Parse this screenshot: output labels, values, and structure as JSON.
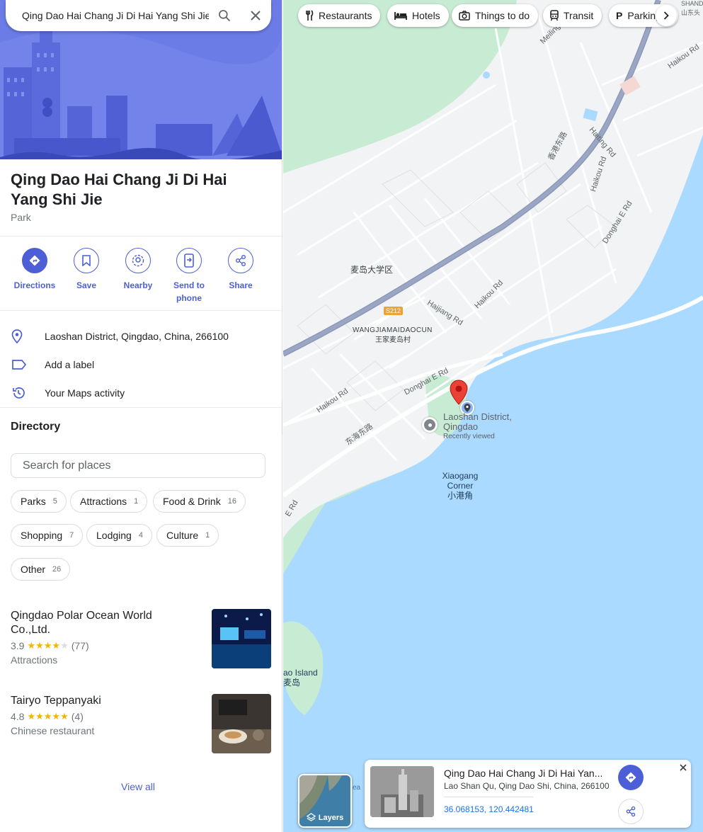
{
  "search": {
    "query": "Qing Dao Hai Chang Ji Di Hai Yang Shi Jie"
  },
  "place": {
    "title": "Qing Dao Hai Chang Ji Di Hai Yang Shi Jie",
    "type": "Park",
    "address": "Laoshan District, Qingdao, China, 266100",
    "add_label": "Add a label",
    "maps_activity": "Your Maps activity"
  },
  "actions": [
    {
      "label": "Directions",
      "icon": "directions-icon"
    },
    {
      "label": "Save",
      "icon": "bookmark-icon"
    },
    {
      "label": "Nearby",
      "icon": "nearby-icon"
    },
    {
      "label": "Send to\nphone",
      "icon": "send-to-phone-icon"
    },
    {
      "label": "Share",
      "icon": "share-icon"
    }
  ],
  "directory": {
    "title": "Directory",
    "search_placeholder": "Search for places",
    "chips": [
      {
        "label": "Parks",
        "count": "5"
      },
      {
        "label": "Attractions",
        "count": "1"
      },
      {
        "label": "Food & Drink",
        "count": "16"
      },
      {
        "label": "Shopping",
        "count": "7"
      },
      {
        "label": "Lodging",
        "count": "4"
      },
      {
        "label": "Culture",
        "count": "1"
      },
      {
        "label": "Other",
        "count": "26"
      }
    ],
    "results": [
      {
        "name": "Qingdao Polar Ocean World Co.,Ltd.",
        "rating": "3.9",
        "stars": 4,
        "reviews": "(77)",
        "category": "Attractions"
      },
      {
        "name": "Tairyo Teppanyaki",
        "rating": "4.8",
        "stars": 5,
        "reviews": "(4)",
        "category": "Chinese restaurant"
      }
    ],
    "view_all": "View all"
  },
  "map": {
    "top_chips": [
      {
        "label": "Restaurants",
        "icon": "fork-knife-icon"
      },
      {
        "label": "Hotels",
        "icon": "bed-icon"
      },
      {
        "label": "Things to do",
        "icon": "camera-icon"
      },
      {
        "label": "Transit",
        "icon": "train-icon"
      },
      {
        "label": "Parking",
        "icon": "parking-icon"
      }
    ],
    "labels": {
      "district_cn": "麦岛大学区",
      "road_badge": "S212",
      "village_en": "WANGJIAMAIDAOCUN",
      "village_cn": "王家麦岛村",
      "pin_label_1": "Laoshan District,",
      "pin_label_2": "Qingdao",
      "recently_viewed": "Recently viewed",
      "corner_1": "Xiaogang",
      "corner_2": "Corner",
      "corner_cn": "小港角",
      "island_en": "ao Island",
      "island_cn": "麦岛",
      "meiling": "Meiling",
      "haikou_rd_1": "Haikou Rd",
      "haikou_rd_2": "Haikou Rd",
      "haikou_rd_3": "Haikou Rd",
      "haikou_rd_4": "Haikou Rd",
      "haiting_rd": "Haiting Rd",
      "donghai_e_rd_1": "Donghai E Rd",
      "donghai_e_rd_2": "Donghai E Rd",
      "donghai_e_rd_3": "E Rd",
      "haijiang_rd": "Haijiang Rd",
      "hongkong_e_cn": "香港东路",
      "donghai_e_cn": "东海东路",
      "shandong_cn": "山东头",
      "shandong_en": "SHANDONG",
      "sea_partial": "ea"
    },
    "layers_label": "Layers",
    "info_card": {
      "title": "Qing Dao Hai Chang Ji Di Hai Yan...",
      "address": "Lao Shan Qu, Qing Dao Shi, China, 266100",
      "coords": "36.068153, 120.442481"
    }
  },
  "colors": {
    "accent": "#4d5fd6",
    "water": "#aadaff",
    "park": "#c8ebd3",
    "land": "#f1f3f4",
    "pin": "#ea4335"
  }
}
